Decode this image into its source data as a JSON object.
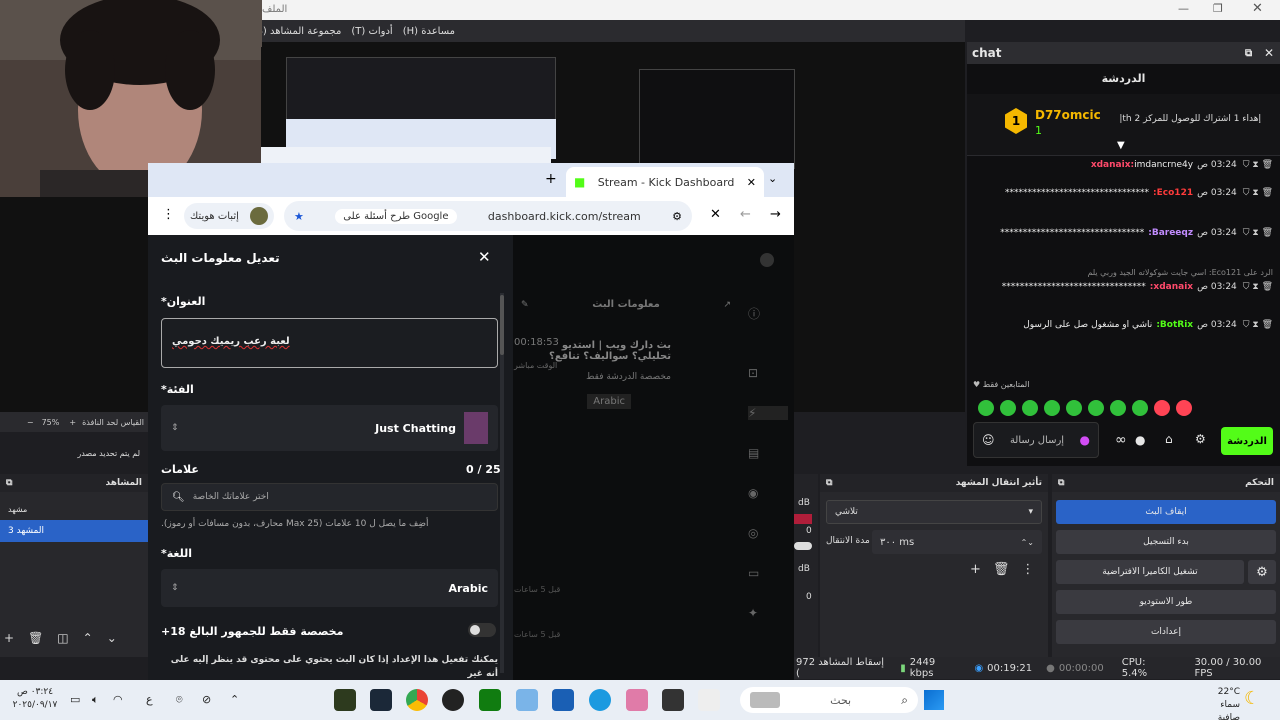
{
  "obs": {
    "title_partial": "الملف",
    "menu": [
      "مساعدة (H)",
      "أدوات (T)",
      "مجموعة المشاهد (S)",
      "("
    ],
    "zoom": "75%",
    "fit_label": "القياس لحد النافذة",
    "no_source": "لم يتم تحديد مصدر",
    "scenes_title": "المشاهد",
    "scenes": [
      "مشهد",
      "المشهد 3"
    ],
    "transition_title": "تأثير انتقال المشهد",
    "transition_value": "تلاشي",
    "duration_label": "مدة الانتقال",
    "duration_value": "٣٠٠ ms",
    "controls_title": "التحكم",
    "controls": [
      "ايقاف البث",
      "بدء التسجيل",
      "تشغيل الكاميرا الافتراضية",
      "طور الاستوديو",
      "إعدادات"
    ],
    "mixer": {
      "db1": "dB",
      "db2": "dB",
      "zero1": "0",
      "zero2": "0"
    },
    "status": {
      "dropped": "إسقاط المشاهد 972 (",
      "kbps": "2449 kbps",
      "live_time": "00:19:21",
      "rec_time": "00:00:00",
      "cpu": "CPU: 5.4%",
      "fps": "30.00 / 30.00 FPS"
    }
  },
  "chat": {
    "dock_title": "chat",
    "header": "الدردشة",
    "pinned_user": "D77omcic",
    "pinned_count": "1",
    "pinned_gift": "إهداء 1 اشتراك للوصول للمركز 2 th|",
    "messages": [
      {
        "user": "xdanaix:",
        "time": "03:24 ص",
        "text": "imdancrne4y",
        "color": "#ff4a6b"
      },
      {
        "user": "Eco121:",
        "time": "03:24 ص",
        "text": "********************************",
        "color": "#ff3b3b"
      },
      {
        "user": "Bareeqz:",
        "time": "03:24 ص",
        "text": "********************************",
        "color": "#c28cff"
      },
      {
        "user": "xdanaix:",
        "time": "03:24 ص",
        "text": "********************************",
        "color": "#ff4a6b",
        "reply": "الرد على Eco121: اسي جايت شوكولاته الجيد وربي يلم"
      },
      {
        "user": "BotRix:",
        "time": "03:24 ص",
        "text": "ناشي او مشغول صل على الرسول",
        "color": "#53fc18"
      }
    ],
    "subs_only": "المتابعين فقط",
    "send_placeholder": "إرسال رسالة",
    "chat_button": "الدردشة",
    "colors": {
      "accent": "#53fc18"
    }
  },
  "browser": {
    "tab_title": "Stream - Kick Dashboard",
    "url": "dashboard.kick.com/stream",
    "search_chip": "طرح أسئلة على Google",
    "profile": "إثبات هويتك"
  },
  "modal": {
    "title": "تعديل معلومات البث",
    "title_label": "العنوان*",
    "title_value": "لعبة رعب ريميك دحومي",
    "category_label": "الفئة*",
    "category_value": "Just Chatting",
    "tags_label": "علامات",
    "tags_count": "0 / 25",
    "tags_placeholder": "اختر علاماتك الخاصة",
    "tags_hint": "أضِف ما يصل ل 10 علامات (Max 25 محارف، بدون مسافات أو رموز).",
    "language_label": "اللغة*",
    "language_value": "Arabic",
    "adult_label": "مخصصة فقط للجمهور البالغ 18+",
    "adult_desc": "يمكنك تفعيل هذا الإعداد إذا كان البث يحتوي على محتوى قد ينظر إليه على أنه غير"
  },
  "kick_bg": {
    "stream_info": "معلومات البث",
    "stream_title": "بث دارك ويب | استديو تحليلي؟ سواليف؟ تنافع؟",
    "timer": "00:18:53",
    "live_label": "الوقت مباشر",
    "chat_only": "مخصصة الدردشة فقط",
    "lang": "Arabic",
    "ago1": "قبل 5 ساعات",
    "ago2": "قبل 5 ساعات"
  },
  "taskbar": {
    "search": "بحث",
    "weather_temp": "22°C",
    "weather_desc": "سماء صافية",
    "time": "٠٣:٢٤ ص",
    "date": "٢٠٢٥/٠٩/١٧",
    "lang": "ع"
  }
}
